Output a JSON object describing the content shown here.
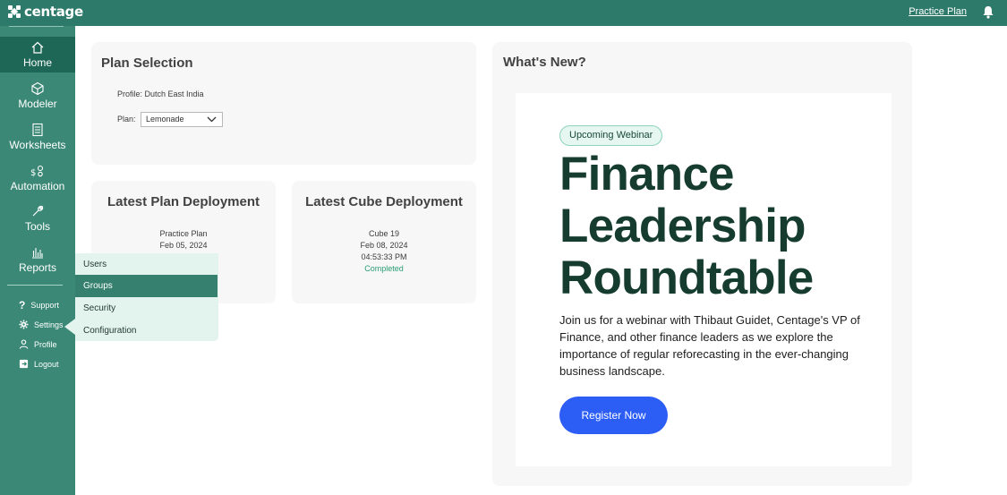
{
  "brand": {
    "name": "centage"
  },
  "topbar": {
    "plan_link": "Practice Plan"
  },
  "sidebar": {
    "items": [
      {
        "label": "Home"
      },
      {
        "label": "Modeler"
      },
      {
        "label": "Worksheets"
      },
      {
        "label": "Automation"
      },
      {
        "label": "Tools"
      },
      {
        "label": "Reports"
      }
    ],
    "utilities": [
      {
        "label": "Support"
      },
      {
        "label": "Settings"
      },
      {
        "label": "Profile"
      },
      {
        "label": "Logout"
      }
    ]
  },
  "settings_menu": {
    "items": [
      "Users",
      "Groups",
      "Security",
      "Configuration"
    ],
    "selected": "Groups"
  },
  "plan_selection": {
    "title": "Plan Selection",
    "profile": "Profile: Dutch East India",
    "plan_label": "Plan:",
    "plan_value": "Lemonade"
  },
  "plan_deployment": {
    "title": "Latest Plan Deployment",
    "name": "Practice Plan",
    "date": "Feb 05, 2024"
  },
  "cube_deployment": {
    "title": "Latest Cube Deployment",
    "name": "Cube 19",
    "date": "Feb 08, 2024",
    "time": "04:53:33 PM",
    "status": "Completed"
  },
  "whats_new": {
    "title": "What's New?",
    "badge": "Upcoming Webinar",
    "headline_1": "Finance",
    "headline_2": "Leadership",
    "headline_3": "Roundtable",
    "body": "Join us for a webinar with Thibaut Guidet, Centage's VP of Finance, and other finance leaders as we explore the importance of regular reforecasting in the ever-changing business landscape.",
    "cta": "Register Now"
  },
  "colors": {
    "topbar": "#2d7a6a",
    "sidebar": "#3b8876",
    "sidebar_active": "#1e6655",
    "status_completed": "#2a9d74",
    "cta": "#2c5ef5",
    "headline": "#153c2e"
  }
}
